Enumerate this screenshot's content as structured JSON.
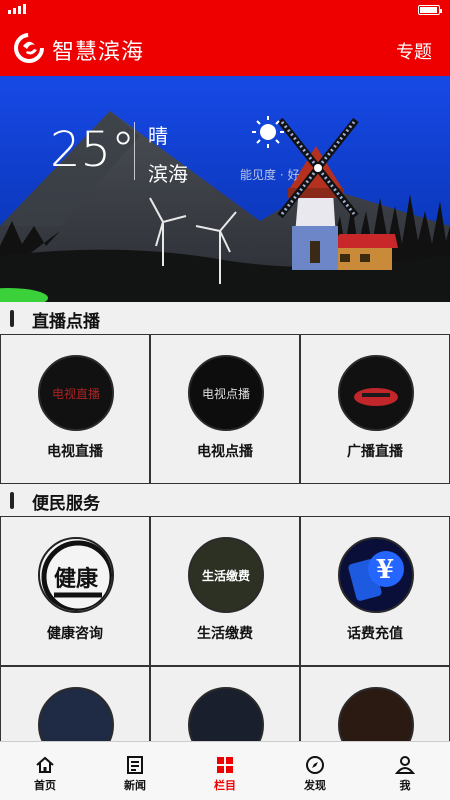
{
  "header": {
    "title": "智慧滨海",
    "topic_label": "专题"
  },
  "weather": {
    "temperature": "25°",
    "condition": "晴",
    "city": "滨海",
    "visibility": "能见度 · 好"
  },
  "live": {
    "section_title": "直播点播",
    "items": [
      {
        "label": "电视直播",
        "thumb_text": "电视直播"
      },
      {
        "label": "电视点播",
        "thumb_text": "电视点播"
      },
      {
        "label": "广播直播",
        "thumb_text": ""
      }
    ]
  },
  "services": {
    "section_title": "便民服务",
    "items": [
      {
        "label": "健康咨询",
        "thumb_text": "健康"
      },
      {
        "label": "生活缴费",
        "thumb_text": "生活缴费"
      },
      {
        "label": "话费充值",
        "thumb_text": "¥"
      }
    ]
  },
  "tabs": [
    {
      "label": "首页",
      "icon": "home-icon"
    },
    {
      "label": "新闻",
      "icon": "news-icon"
    },
    {
      "label": "栏目",
      "icon": "grid-icon",
      "active": true
    },
    {
      "label": "发现",
      "icon": "compass-icon"
    },
    {
      "label": "我",
      "icon": "user-icon"
    }
  ],
  "colors": {
    "brand": "#ee0000",
    "sky": "#0a3fd0",
    "active_tab": "#ee0000"
  }
}
